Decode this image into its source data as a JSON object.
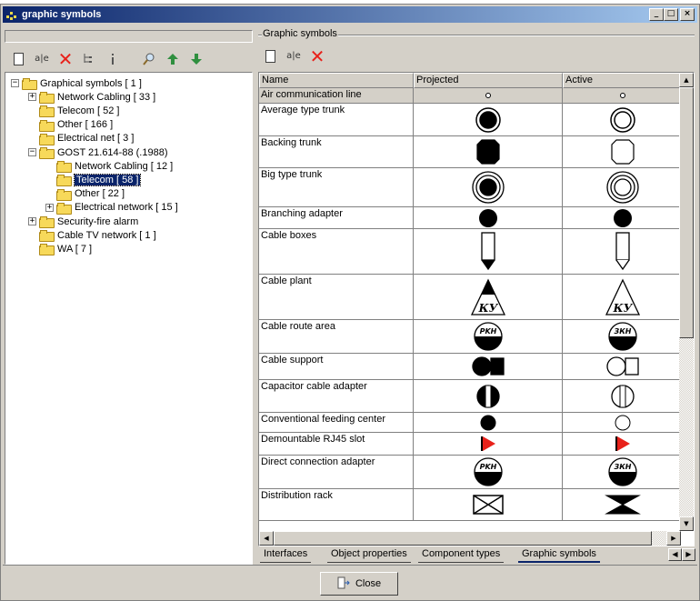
{
  "window": {
    "title": "graphic symbols"
  },
  "left_toolbar": {
    "icons": [
      "new-document-icon",
      "rename-icon",
      "delete-icon",
      "tree-structure-icon",
      "info-icon",
      "find-icon",
      "move-up-icon",
      "move-down-icon"
    ],
    "rename_label": "a|e"
  },
  "tree": {
    "nodes": [
      {
        "label": "Graphical symbols [ 1 ]",
        "expander": "−"
      },
      {
        "label": "Network Cabling [ 33 ]",
        "expander": "+"
      },
      {
        "label": "Telecom [ 52 ]",
        "expander": ""
      },
      {
        "label": "Other [ 166 ]",
        "expander": ""
      },
      {
        "label": "Electrical net [ 3 ]",
        "expander": ""
      },
      {
        "label": "GOST 21.614-88 (.1988)",
        "expander": "−"
      },
      {
        "label": "Network Cabling [ 12 ]",
        "expander": ""
      },
      {
        "label": "Telecom [ 58 ]",
        "expander": "",
        "selected": true
      },
      {
        "label": "Other [ 22 ]",
        "expander": ""
      },
      {
        "label": "Electrical network [ 15 ]",
        "expander": "+"
      },
      {
        "label": "Security-fire alarm",
        "expander": "+"
      },
      {
        "label": "Cable TV network [ 1 ]",
        "expander": ""
      },
      {
        "label": "WA [ 7 ]",
        "expander": ""
      }
    ]
  },
  "right": {
    "group_label": "Graphic symbols",
    "rename_label": "a|e",
    "columns": [
      "Name",
      "Projected",
      "Active"
    ],
    "rows": [
      {
        "name": "Air communication line",
        "symbol": "dot"
      },
      {
        "name": "Average type trunk",
        "symbol": "ring-filled"
      },
      {
        "name": "Backing trunk",
        "symbol": "octagon"
      },
      {
        "name": "Big type trunk",
        "symbol": "triple-ring"
      },
      {
        "name": "Branching adapter",
        "symbol": "disc"
      },
      {
        "name": "Cable boxes",
        "symbol": "box-arrow"
      },
      {
        "name": "Cable plant",
        "symbol": "triangle-ky",
        "text": "КУ"
      },
      {
        "name": "Cable route area",
        "symbol": "half-disc-label",
        "text": "PKH",
        "active_text": "ЗКН"
      },
      {
        "name": "Cable support",
        "symbol": "disc-square"
      },
      {
        "name": "Capacitor cable adapter",
        "symbol": "split-disc"
      },
      {
        "name": "Conventional feeding center",
        "symbol": "small-disc"
      },
      {
        "name": "Demountable RJ45 slot",
        "symbol": "red-flag"
      },
      {
        "name": "Direct connection adapter",
        "symbol": "half-disc-label",
        "text": "PKH",
        "active_text": "ЗКН"
      },
      {
        "name": "Distribution rack",
        "symbol": "bowtie-box"
      }
    ],
    "tabs": [
      "Interfaces",
      "Object properties",
      "Component types",
      "Graphic symbols"
    ],
    "active_tab": "Graphic symbols"
  },
  "close_button": {
    "label": "Close"
  }
}
